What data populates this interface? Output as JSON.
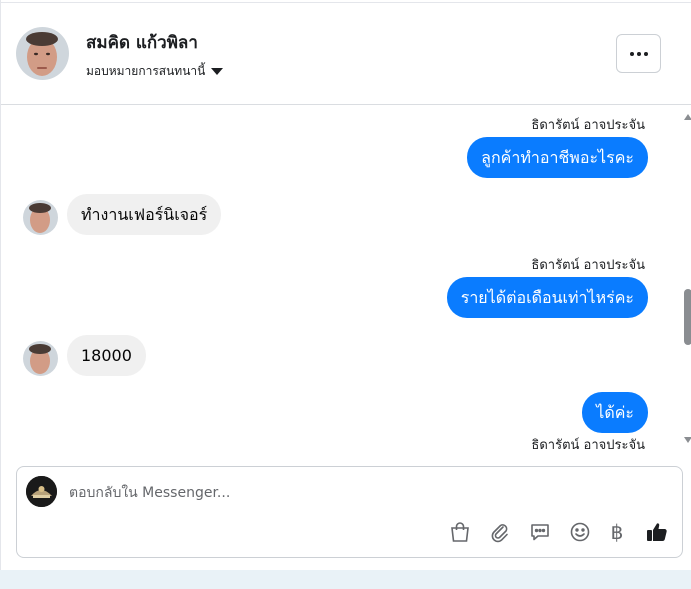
{
  "header": {
    "contact_name": "สมคิด แก้วพิลา",
    "assign_label": "มอบหมายการสนทนานี้"
  },
  "messages": [
    {
      "direction": "out",
      "sender": "ธิดารัตน์ อาจประจัน",
      "text": "ลูกค้าทำอาชีพอะไรคะ"
    },
    {
      "direction": "in",
      "text": "ทำงานเฟอร์นิเจอร์"
    },
    {
      "direction": "out",
      "sender": "ธิดารัตน์ อาจประจัน",
      "text": "รายได้ต่อเดือนเท่าไหร่คะ"
    },
    {
      "direction": "in",
      "text": "18000"
    },
    {
      "direction": "out",
      "sender": "ธิดารัตน์ อาจประจัน",
      "text": "ได้ค่ะ"
    }
  ],
  "composer": {
    "placeholder": "ตอบกลับใน Messenger...",
    "tools": [
      "shopping-bag-icon",
      "paperclip-icon",
      "saved-reply-icon",
      "emoji-icon",
      "baht-icon",
      "thumbs-up-icon"
    ],
    "baht_symbol": "฿"
  },
  "colors": {
    "outgoing_bubble": "#0a7cff",
    "incoming_bubble": "#f0f0f0",
    "like_icon": "#1c1e21"
  }
}
